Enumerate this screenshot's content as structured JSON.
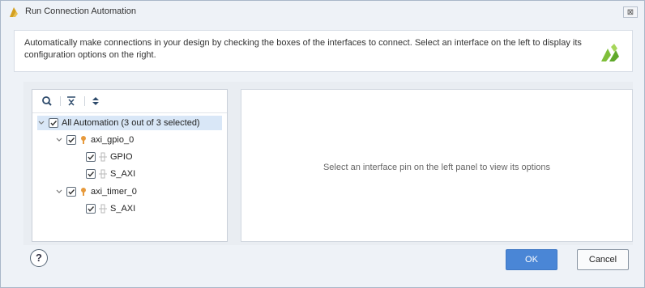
{
  "window": {
    "title": "Run Connection Automation",
    "close_label": "⊠"
  },
  "description": "Automatically make connections in your design by checking the boxes of the interfaces to connect. Select an interface on the left to display its configuration options on the right.",
  "tree": {
    "toolbar": [
      "search-icon",
      "collapse-all-icon",
      "expand-all-icon"
    ],
    "items": [
      {
        "label": "All Automation (3 out of 3 selected)",
        "checked": true,
        "selected": true,
        "expanded": true
      },
      {
        "label": "axi_gpio_0",
        "checked": true,
        "expanded": true,
        "icon": "ip-block-icon"
      },
      {
        "label": "GPIO",
        "checked": true,
        "icon": "interface-pin-icon"
      },
      {
        "label": "S_AXI",
        "checked": true,
        "icon": "interface-pin-icon"
      },
      {
        "label": "axi_timer_0",
        "checked": true,
        "expanded": true,
        "icon": "ip-block-icon"
      },
      {
        "label": "S_AXI",
        "checked": true,
        "icon": "interface-pin-icon"
      }
    ]
  },
  "right_panel": {
    "placeholder": "Select an interface pin on the left panel to view its options"
  },
  "buttons": {
    "help": "?",
    "ok": "OK",
    "cancel": "Cancel"
  },
  "colors": {
    "accent": "#4a86d6",
    "logo": "#8cc63f",
    "ip_icon": "#e79a3c",
    "selection": "#d9e7f7"
  }
}
